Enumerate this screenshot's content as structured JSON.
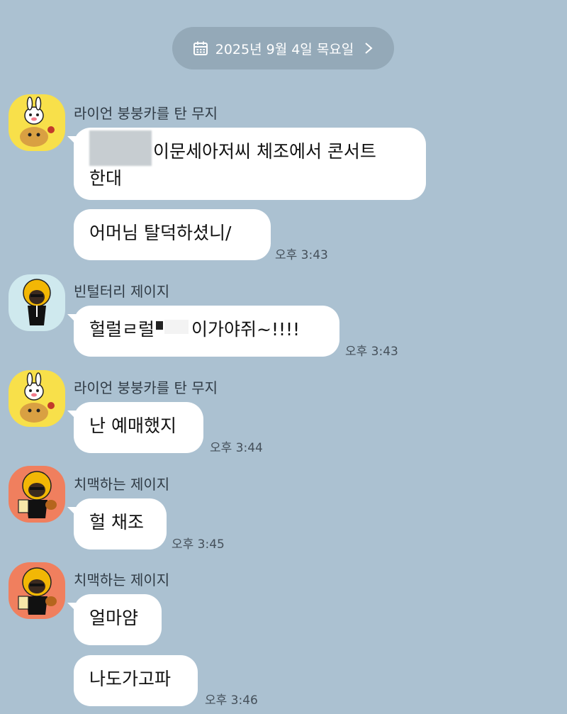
{
  "date_divider": {
    "label": "2025년 9월 4일 목요일",
    "icon": "calendar-icon",
    "chevron": "chevron-right-icon"
  },
  "colors": {
    "background": "#abc1d1",
    "bubble": "#ffffff",
    "pill": "#94a9b8"
  },
  "messages": [
    {
      "sender": "라이언 붕붕카를 탄 무지",
      "avatar": "muzi-ryan-car-avatar",
      "bubbles": [
        {
          "line1": "이문세아저씨 체조에서 콘서트",
          "line2": "한대"
        },
        {
          "text": "어머님 탈덕하셨니/"
        }
      ],
      "time": "오후 3:43"
    },
    {
      "sender": "빈털터리 제이지",
      "avatar": "jay-g-avatar",
      "bubbles": [
        {
          "pre": "헐럴ㄹ럴",
          "post": "이가야쥐~!!!!"
        }
      ],
      "time": "오후 3:43"
    },
    {
      "sender": "라이언 붕붕카를 탄 무지",
      "avatar": "muzi-ryan-car-avatar",
      "bubbles": [
        {
          "text": "난 예매했지"
        }
      ],
      "time": "오후 3:44"
    },
    {
      "sender": "치맥하는 제이지",
      "avatar": "jay-g-chimaek-avatar",
      "bubbles": [
        {
          "text": "헐 채조"
        }
      ],
      "time": "오후 3:45"
    },
    {
      "sender": "치맥하는 제이지",
      "avatar": "jay-g-chimaek-avatar",
      "bubbles": [
        {
          "text": "얼마얌"
        },
        {
          "text": "나도가고파"
        }
      ],
      "time": "오후 3:46"
    }
  ]
}
